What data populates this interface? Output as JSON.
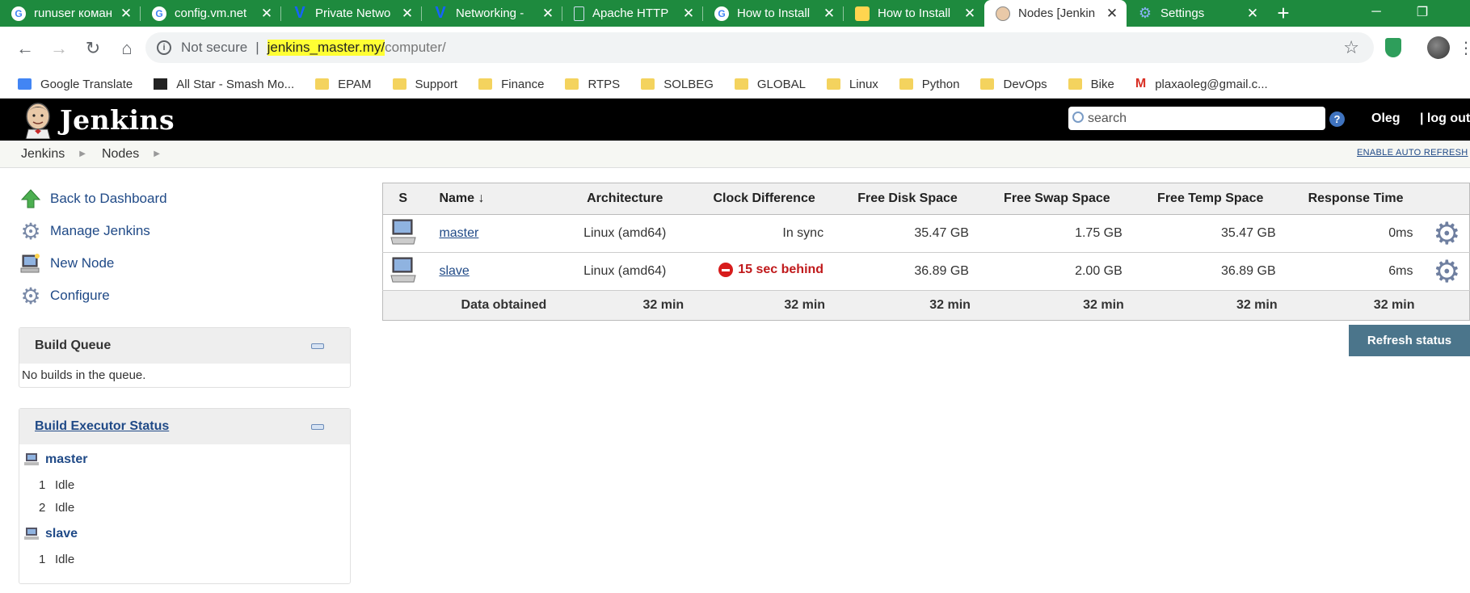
{
  "browser": {
    "tabs": [
      {
        "label": "runuser коман",
        "favicon": "google-icon",
        "active": false
      },
      {
        "label": "config.vm.net",
        "favicon": "google-icon",
        "active": false
      },
      {
        "label": "Private Netwo",
        "favicon": "vagrant-icon",
        "active": false
      },
      {
        "label": "Networking -",
        "favicon": "vagrant-icon",
        "active": false
      },
      {
        "label": "Apache HTTP",
        "favicon": "page-icon",
        "active": false
      },
      {
        "label": "How to Install",
        "favicon": "google-icon",
        "active": false
      },
      {
        "label": "How to Install",
        "favicon": "bulb-icon",
        "active": false
      },
      {
        "label": "Nodes [Jenkin",
        "favicon": "jenkins-icon",
        "active": true
      },
      {
        "label": "Settings",
        "favicon": "gear-icon",
        "active": false
      }
    ],
    "new_tab": "+",
    "window_controls": {
      "minimize": "─",
      "maximize": "❐"
    },
    "address": {
      "security_label": "Not secure",
      "host": "jenkins_master.my/",
      "path": "computer/"
    },
    "bookmarks": [
      {
        "label": "Google Translate",
        "icon": "google-translate-icon"
      },
      {
        "label": "All Star - Smash Mo...",
        "icon": "allstar-icon"
      },
      {
        "label": "EPAM",
        "icon": "folder-icon"
      },
      {
        "label": "Support",
        "icon": "folder-icon"
      },
      {
        "label": "Finance",
        "icon": "folder-icon"
      },
      {
        "label": "RTPS",
        "icon": "folder-icon"
      },
      {
        "label": "SOLBEG",
        "icon": "folder-icon"
      },
      {
        "label": "GLOBAL",
        "icon": "folder-icon"
      },
      {
        "label": "Linux",
        "icon": "folder-icon"
      },
      {
        "label": "Python",
        "icon": "folder-icon"
      },
      {
        "label": "DevOps",
        "icon": "folder-icon"
      },
      {
        "label": "Bike",
        "icon": "folder-icon"
      },
      {
        "label": "plaxaoleg@gmail.c...",
        "icon": "gmail-icon"
      }
    ]
  },
  "jenkins": {
    "logo_text": "Jenkins",
    "search_placeholder": "search",
    "help": "?",
    "user": "Oleg",
    "logout": "| log out",
    "breadcrumbs": [
      "Jenkins",
      "Nodes"
    ],
    "auto_refresh": "ENABLE AUTO REFRESH",
    "tasks": [
      {
        "label": "Back to Dashboard",
        "icon": "up-arrow-icon"
      },
      {
        "label": "Manage Jenkins",
        "icon": "gear-icon"
      },
      {
        "label": "New Node",
        "icon": "computer-icon"
      },
      {
        "label": "Configure",
        "icon": "gear-icon"
      }
    ],
    "build_queue": {
      "title": "Build Queue",
      "empty": "No builds in the queue."
    },
    "executor_status": {
      "title": "Build Executor Status",
      "nodes": [
        {
          "name": "master",
          "executors": [
            {
              "num": "1",
              "state": "Idle"
            },
            {
              "num": "2",
              "state": "Idle"
            }
          ]
        },
        {
          "name": "slave",
          "executors": [
            {
              "num": "1",
              "state": "Idle"
            }
          ]
        }
      ]
    },
    "nodes_table": {
      "headers": [
        "S",
        "Name ↓",
        "Architecture",
        "Clock Difference",
        "Free Disk Space",
        "Free Swap Space",
        "Free Temp Space",
        "Response Time"
      ],
      "rows": [
        {
          "name": "master",
          "arch": "Linux (amd64)",
          "clock": "In sync",
          "clock_warn": false,
          "disk": "35.47 GB",
          "swap": "1.75 GB",
          "temp": "35.47 GB",
          "response": "0ms"
        },
        {
          "name": "slave",
          "arch": "Linux (amd64)",
          "clock": "15 sec behind",
          "clock_warn": true,
          "disk": "36.89 GB",
          "swap": "2.00 GB",
          "temp": "36.89 GB",
          "response": "6ms"
        }
      ],
      "footer": {
        "label": "Data obtained",
        "values": [
          "32 min",
          "32 min",
          "32 min",
          "32 min",
          "32 min",
          "32 min"
        ]
      }
    },
    "refresh_button": "Refresh status"
  },
  "colors": {
    "chrome_tabstrip": "#1e8a3e",
    "jenkins_header": "#000000",
    "link": "#204a87",
    "warning": "#c0191b",
    "button": "#4b758b"
  }
}
